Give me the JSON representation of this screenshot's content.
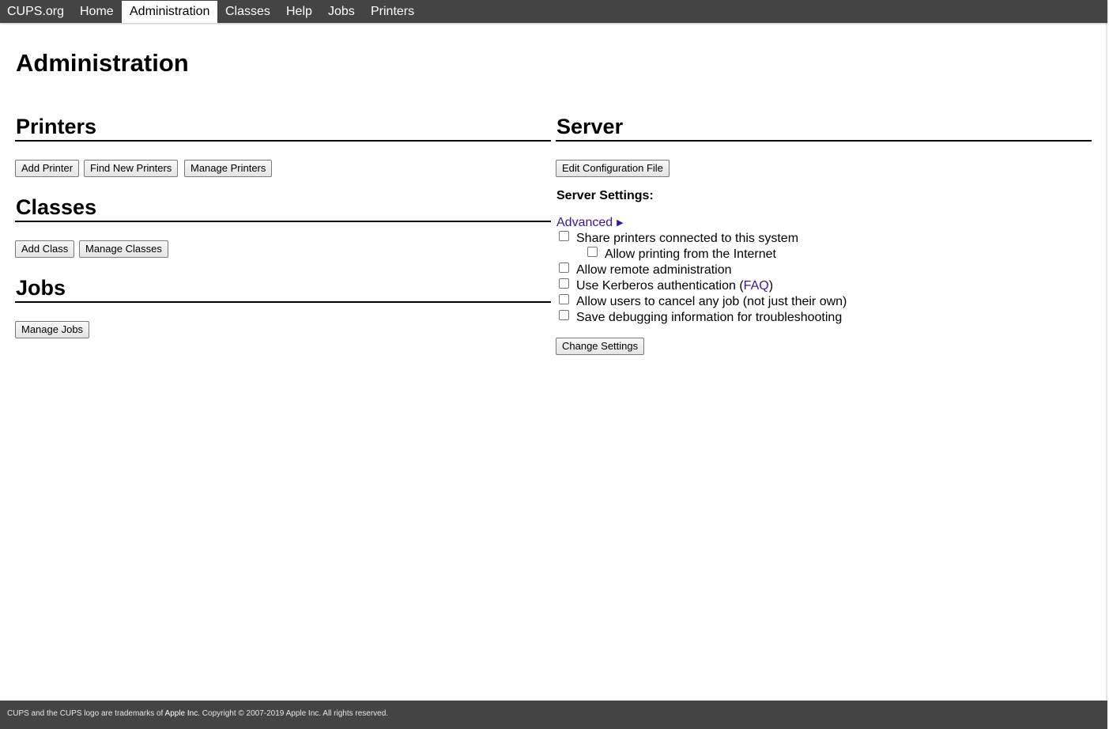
{
  "nav": {
    "items": [
      {
        "label": "CUPS.org"
      },
      {
        "label": "Home"
      },
      {
        "label": "Administration"
      },
      {
        "label": "Classes"
      },
      {
        "label": "Help"
      },
      {
        "label": "Jobs"
      },
      {
        "label": "Printers"
      }
    ],
    "active": "Administration"
  },
  "page": {
    "title": "Administration"
  },
  "printers": {
    "title": "Printers",
    "buttons": [
      "Add Printer",
      "Find New Printers",
      "Manage Printers"
    ]
  },
  "classes": {
    "title": "Classes",
    "buttons": [
      "Add Class",
      "Manage Classes"
    ]
  },
  "jobs": {
    "title": "Jobs",
    "buttons": [
      "Manage Jobs"
    ]
  },
  "server": {
    "title": "Server",
    "edit_config_label": "Edit Configuration File",
    "settings_label": "Server Settings:",
    "advanced_label": "Advanced",
    "options": [
      {
        "label": "Share printers connected to this system",
        "checked": false
      },
      {
        "label": "Allow printing from the Internet",
        "checked": false
      },
      {
        "label": "Allow remote administration",
        "checked": false
      },
      {
        "label_before": "Use Kerberos authentication (",
        "link": "FAQ",
        "label_after": ")",
        "checked": false
      },
      {
        "label": "Allow users to cancel any job (not just their own)",
        "checked": false
      },
      {
        "label": "Save debugging information for troubleshooting",
        "checked": false
      }
    ],
    "change_settings_label": "Change Settings"
  },
  "footer": {
    "text_before": "CUPS and the CUPS logo are trademarks of ",
    "link": "Apple Inc.",
    "text_after": " Copyright © 2007-2019 Apple Inc. All rights reserved."
  },
  "colors": {
    "nav_bg": "#444444",
    "link": "#3a14a0",
    "footer_bg": "#444444"
  }
}
